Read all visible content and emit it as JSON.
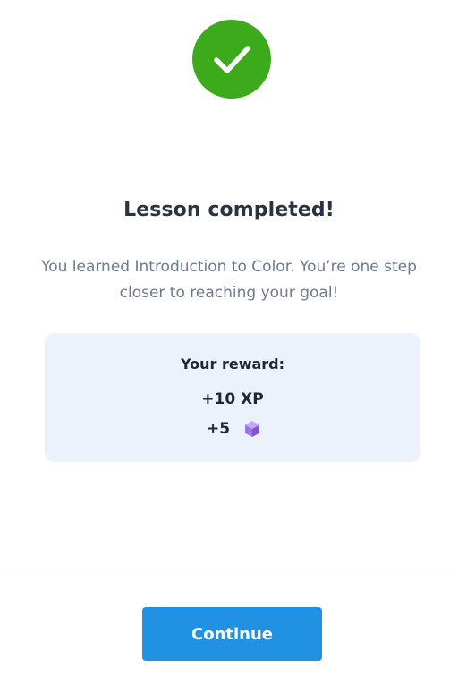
{
  "status_icon": "checkmark-icon",
  "colors": {
    "success": "#3caa1b",
    "accent": "#2192e3",
    "card_background": "#ebf2fc",
    "gem": "#9b73e8"
  },
  "heading": "Lesson completed!",
  "message": "You learned Introduction to Color. You’re one step closer to reaching your goal!",
  "reward": {
    "title": "Your reward:",
    "xp": "+10 XP",
    "gems": "+5",
    "gem_icon": "gem-cube-icon"
  },
  "continue_label": "Continue"
}
